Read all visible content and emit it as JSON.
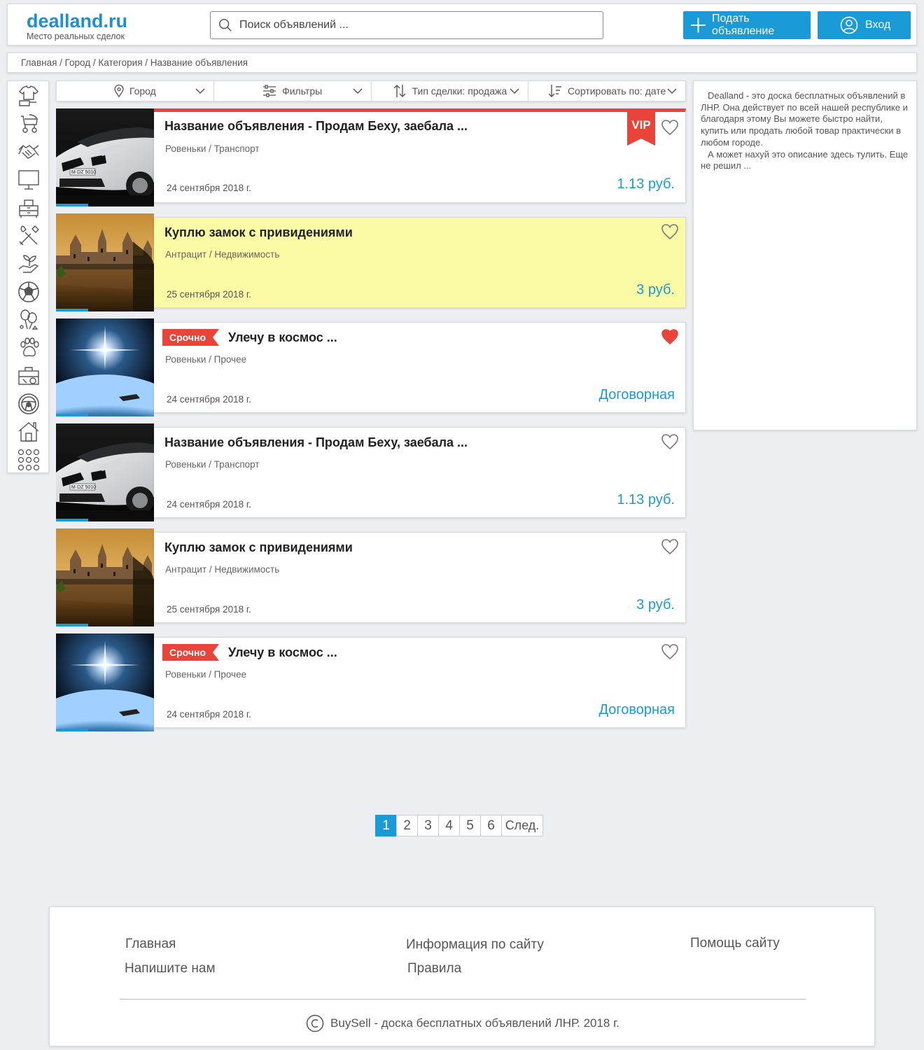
{
  "header": {
    "logo_title": "dealland.ru",
    "logo_subtitle": "Место реальных сделок",
    "search_placeholder": "Поиск объявлений ...",
    "post_button": "Подать объявление",
    "login_button": "Вход"
  },
  "breadcrumb": "Главная / Город / Категория / Название объявления",
  "categories": [
    "clothes-icon",
    "stroller-icon",
    "handshake-icon",
    "monitor-icon",
    "furniture-icon",
    "tools-icon",
    "plant-hand-icon",
    "soccer-ball-icon",
    "balloons-icon",
    "paw-icon",
    "briefcase-icon",
    "steering-wheel-icon",
    "house-icon",
    "all-categories-icon"
  ],
  "filters": {
    "city": "Город",
    "filters": "Фильтры",
    "deal_type": "Тип сделки: продажа",
    "sort": "Сортировать по: дате"
  },
  "listings": [
    {
      "title": "Название объявления - Продам Беху, заебала ...",
      "meta": "Ровеньки / Транспорт",
      "date": "24 сентября 2018 г.",
      "price": "1.13 руб.",
      "badge": "VIP",
      "favorite": false
    },
    {
      "title": "Куплю замок с привидениями",
      "meta": "Антрацит / Недвижимость",
      "date": "25 сентября 2018 г.",
      "price": "3 руб.",
      "favorite": false
    },
    {
      "title": "Улечу в космос ...",
      "meta": "Ровеньки / Прочее",
      "date": "24 сентября 2018 г.",
      "price": "Договорная",
      "badge": "Срочно",
      "favorite": true
    },
    {
      "title": "Название объявления - Продам Беху, заебала ...",
      "meta": "Ровеньки / Транспорт",
      "date": "24 сентября 2018 г.",
      "price": "1.13 руб.",
      "favorite": false
    },
    {
      "title": "Куплю замок с привидениями",
      "meta": "Антрацит / Недвижимость",
      "date": "25 сентября 2018 г.",
      "price": "3 руб.",
      "favorite": false
    },
    {
      "title": "Улечу в космос ...",
      "meta": "Ровеньки / Прочее",
      "date": "24 сентября 2018 г.",
      "price": "Договорная",
      "badge": "Срочно",
      "favorite": false
    }
  ],
  "description": {
    "p1": "Dealland - это доска бесплатных объявлений в ЛНР. Она действует по всей нашей республике и благодаря этому Вы можете быстро найти, купить или продать любой товар практически в любом городе.",
    "p2": "А может нахуй это описание здесь тулить. Еще не решил ..."
  },
  "pagination": {
    "pages": [
      "1",
      "2",
      "3",
      "4",
      "5",
      "6"
    ],
    "active": "1",
    "next": "След."
  },
  "footer": {
    "home": "Главная",
    "contact": "Напишите нам",
    "info": "Информация по сайту",
    "rules": "Правила",
    "help": "Помощь сайту",
    "copyright": "BuySell - доска бесплатных объявлений ЛНР. 2018 г."
  },
  "colors": {
    "accent": "#1a9ad6",
    "badge_red": "#e8443a",
    "highlight_yellow": "#fafaa4",
    "background": "#eceef1"
  }
}
